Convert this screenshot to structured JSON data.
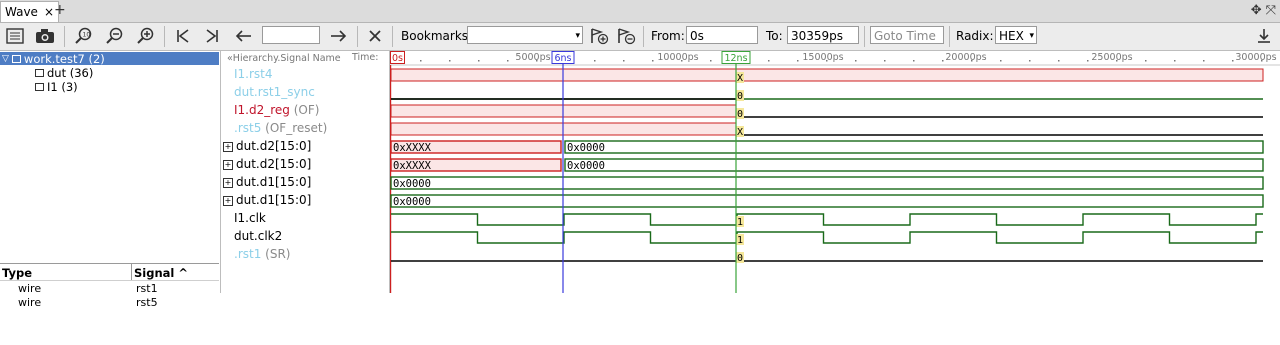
{
  "tab": {
    "label": "Wave",
    "close": "×",
    "add": "+"
  },
  "toolbar": {
    "bookmarks_label": "Bookmarks:",
    "bookmarks_value": "",
    "from_label": "From:",
    "from_value": "0s",
    "to_label": "To:",
    "to_value": "30359ps",
    "goto_placeholder": "Goto Time",
    "radix_label": "Radix:",
    "radix_value": "HEX"
  },
  "tree": [
    {
      "label": "work.test7 (2)",
      "selected": true
    },
    {
      "label": "dut (36)"
    },
    {
      "label": "I1 (3)"
    }
  ],
  "type_table": {
    "headers": {
      "type": "Type",
      "signal": "Signal ^"
    },
    "rows": [
      {
        "type": "wire",
        "signal": "rst1"
      },
      {
        "type": "wire",
        "signal": "rst5"
      }
    ]
  },
  "names_header": {
    "hierarchy": "«Hierarchy.Signal Name",
    "time": "Time:"
  },
  "signals": [
    {
      "name": "I1.rst4",
      "sub": "",
      "color": "#8ccfe8",
      "expandable": false
    },
    {
      "name": "dut.rst1_sync",
      "sub": "",
      "color": "#8ccfe8",
      "expandable": false
    },
    {
      "name": "I1.d2_reg",
      "sub": "(OF)",
      "color": "#c0142b",
      "expandable": false
    },
    {
      "name": ".rst5",
      "sub": "(OF_reset)",
      "color": "#8ccfe8",
      "expandable": false
    },
    {
      "name": "dut.d2[15:0]",
      "sub": "",
      "color": "#000000",
      "expandable": true
    },
    {
      "name": "dut.d2[15:0]",
      "sub": "",
      "color": "#000000",
      "expandable": true
    },
    {
      "name": "dut.d1[15:0]",
      "sub": "",
      "color": "#000000",
      "expandable": true
    },
    {
      "name": "dut.d1[15:0]",
      "sub": "",
      "color": "#000000",
      "expandable": true
    },
    {
      "name": "I1.clk",
      "sub": "",
      "color": "#000000",
      "expandable": false
    },
    {
      "name": "dut.clk2",
      "sub": "",
      "color": "#000000",
      "expandable": false
    },
    {
      "name": ".rst1",
      "sub": "(SR)",
      "color": "#8ccfe8",
      "expandable": false
    }
  ],
  "timeline": {
    "start_marker": "0s",
    "cursor_marker": "6ns",
    "center_marker": "12ns",
    "ticks": [
      "5000ps",
      "10000ps",
      "15000ps",
      "20000ps",
      "25000ps",
      "30000ps"
    ]
  },
  "waves": {
    "rst4_value": "X",
    "rst1_sync_value": "0",
    "d2_reg_value": "0",
    "rst5_value": "X",
    "d2a_values": [
      "0xXXXX",
      "0x0000"
    ],
    "d2b_values": [
      "0xXXXX",
      "0x0000"
    ],
    "d1a_value": "0x0000",
    "d1b_value": "0x0000",
    "clk_value": "1",
    "clk2_value": "1",
    "rst1_value": "0"
  },
  "colors": {
    "wave_green": "#1a6a1a",
    "error_red": "#cc2020",
    "error_fill": "#fbe6e6",
    "cursor_blue": "#3a3adb",
    "center_green": "#3aa33a",
    "value_yellow": "#f5e79a",
    "selection_blue": "#4e7dc4"
  }
}
